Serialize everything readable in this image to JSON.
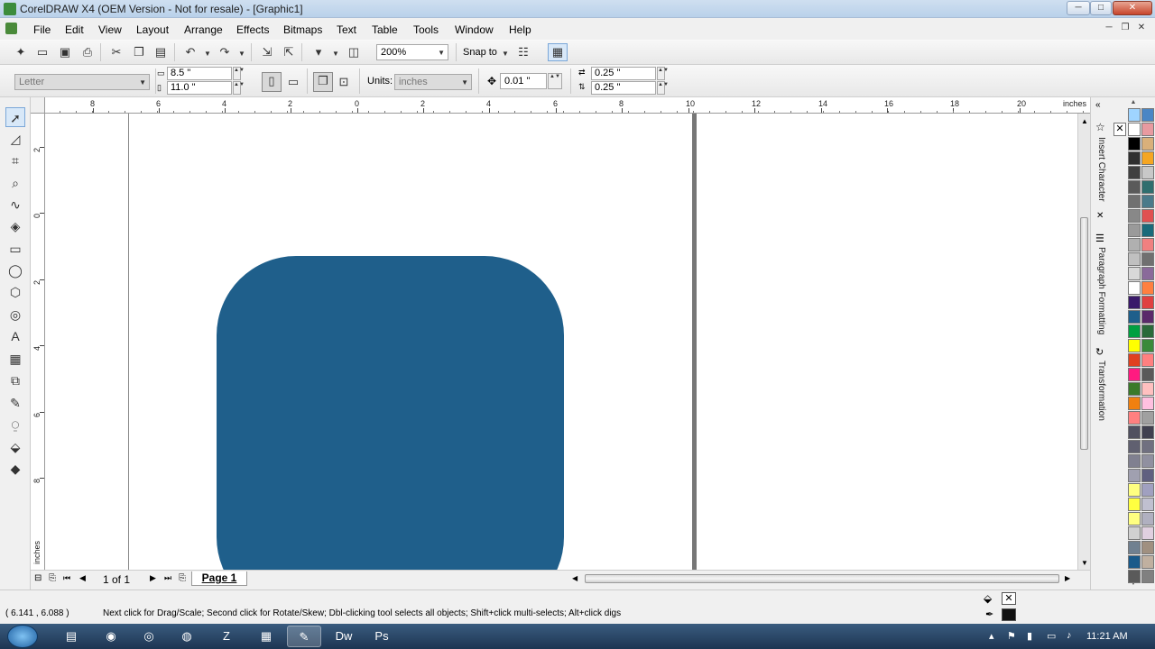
{
  "window": {
    "title": "CorelDRAW X4 (OEM Version - Not for resale) - [Graphic1]",
    "controls": {
      "minimize": "─",
      "maximize": "□",
      "close": "✕"
    }
  },
  "menubar": {
    "items": [
      "File",
      "Edit",
      "View",
      "Layout",
      "Arrange",
      "Effects",
      "Bitmaps",
      "Text",
      "Table",
      "Tools",
      "Window",
      "Help"
    ],
    "doc_controls": {
      "minimize": "─",
      "restore": "❐",
      "close": "✕"
    }
  },
  "toolbar_standard": {
    "zoom_level": "200%",
    "snap_to_label": "Snap to"
  },
  "property_bar": {
    "paper_type": "Letter",
    "page_width": "8.5 \"",
    "page_height": "11.0 \"",
    "units_label": "Units:",
    "units_value": "inches",
    "nudge": "0.01 \"",
    "duplicate_x": "0.25 \"",
    "duplicate_y": "0.25 \""
  },
  "rulers": {
    "unit": "inches",
    "horizontal_labels": [
      "8",
      "6",
      "4",
      "2",
      "0",
      "2",
      "4",
      "6",
      "8",
      "10",
      "12",
      "14",
      "16",
      "18",
      "20"
    ],
    "vertical_labels": [
      "2",
      "0",
      "2",
      "4",
      "6",
      "8"
    ]
  },
  "canvas": {
    "shape_color": "#1f5f8b",
    "page_border_color": "#777777"
  },
  "page_nav": {
    "page_count": "1 of 1",
    "page_tab": "Page 1"
  },
  "dockers": [
    "Insert Character",
    "Paragraph Formatting",
    "Transformation"
  ],
  "palette_colors": [
    "#9fd4ff",
    "#4a86c5",
    "#ffffff",
    "#e89aa0",
    "#000000",
    "#d9b07a",
    "#303030",
    "#f5a623",
    "#404040",
    "#c8c8c8",
    "#5a5a5a",
    "#2f6e6e",
    "#707070",
    "#4a7a8a",
    "#888888",
    "#e05050",
    "#9a9a9a",
    "#1a6a7a",
    "#b0b0b0",
    "#f08080",
    "#c0c0c0",
    "#707070",
    "#d8d8d8",
    "#8a6a9a",
    "#ffffff",
    "#ff8040",
    "#3a1a6a",
    "#e04040",
    "#1f5f8b",
    "#5a2a6a",
    "#00a040",
    "#2a6a3a",
    "#ffff00",
    "#3a8a3a",
    "#e04020",
    "#ff8080",
    "#ff1a80",
    "#5a5a5a",
    "#3a7a2a",
    "#ffc0c0",
    "#f08010",
    "#ffc0e0",
    "#ff8080",
    "#a0a0a0",
    "#505060",
    "#404050",
    "#606070",
    "#707080",
    "#808090",
    "#9090a0",
    "#a0a0b0",
    "#606080",
    "#ffff80",
    "#a0a0c0",
    "#ffff40",
    "#c0c0d0",
    "#ffff80",
    "#b0b0c0",
    "#d0d0d0",
    "#e0d0e0",
    "#708090",
    "#a09080",
    "#1a5a8a",
    "#c0b0a0",
    "#5a5a5a",
    "#808080"
  ],
  "status": {
    "coordinates": "( 6.141 , 6.088 )",
    "message": "Next click for Drag/Scale; Second click for Rotate/Skew; Dbl-clicking tool selects all objects; Shift+click multi-selects; Alt+click digs"
  },
  "taskbar": {
    "apps": [
      "explorer-icon",
      "media-player-icon",
      "chrome-icon",
      "firefox-icon",
      "filezilla-icon",
      "notepad-icon",
      "coreldraw-icon",
      "dreamweaver-icon",
      "photoshop-icon"
    ],
    "app_glyphs": [
      "▤",
      "◉",
      "◎",
      "◍",
      "Z",
      "▦",
      "✎",
      "Dw",
      "Ps"
    ],
    "clock": "11:21 AM"
  }
}
